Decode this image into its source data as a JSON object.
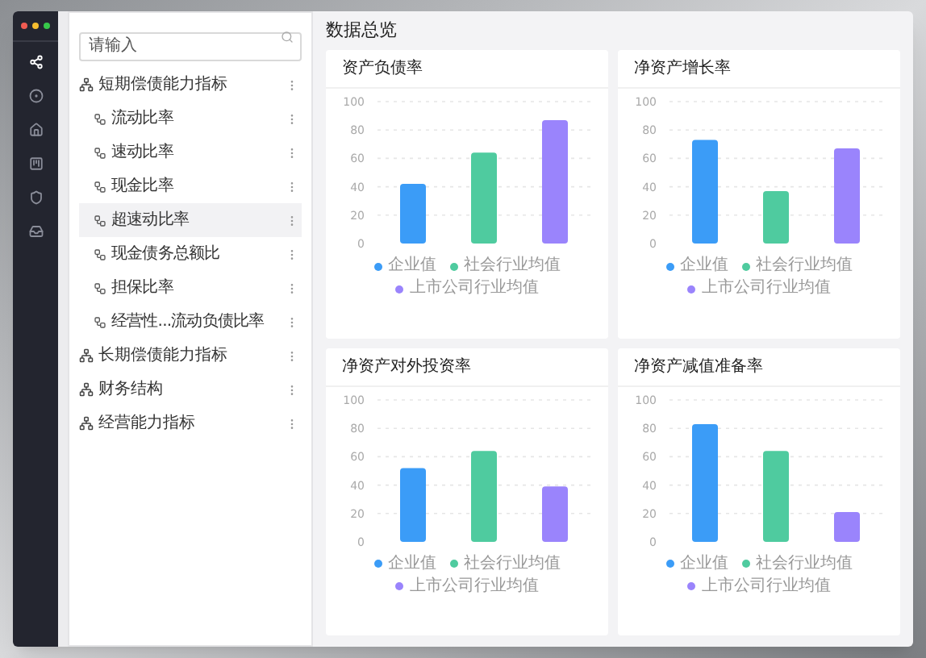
{
  "window": {
    "controls": [
      {
        "kind": "close"
      },
      {
        "kind": "minimize"
      },
      {
        "kind": "maximize"
      }
    ]
  },
  "sidebar": {
    "items": [
      {
        "selected": true
      },
      {
        "selected": false
      },
      {
        "selected": false
      },
      {
        "selected": false
      },
      {
        "selected": false
      },
      {
        "selected": false
      }
    ]
  },
  "search": {
    "placeholder": "请输入"
  },
  "tree": [
    {
      "label": "短期偿债能力指标",
      "children": [
        {
          "label": "流动比率",
          "selected": false
        },
        {
          "label": "速动比率",
          "selected": false
        },
        {
          "label": "现金比率",
          "selected": false
        },
        {
          "label": "超速动比率",
          "selected": true
        },
        {
          "label": "现金债务总额比",
          "selected": false
        },
        {
          "label": "担保比率",
          "selected": false
        },
        {
          "label": "经营性...流动负债比率",
          "selected": false
        }
      ]
    },
    {
      "label": "长期偿债能力指标"
    },
    {
      "label": "财务结构"
    },
    {
      "label": "经营能力指标"
    }
  ],
  "main": {
    "title": "数据总览",
    "cards": [
      {
        "title": "资产负债率",
        "chart_data": {
          "type": "bar",
          "grid": true,
          "legend": "bottom",
          "ylim": [
            0,
            100
          ],
          "yticks": [
            0,
            20,
            40,
            60,
            80,
            100
          ],
          "series": [
            {
              "name": "企业值",
              "color": "#3b9cf7",
              "values": [
                42
              ]
            },
            {
              "name": "社会行业均值",
              "color": "#4fcb9f",
              "values": [
                64
              ]
            },
            {
              "name": "上市公司行业均值",
              "color": "#9a84fc",
              "values": [
                87
              ]
            }
          ]
        }
      },
      {
        "title": "净资产增长率",
        "chart_data": {
          "type": "bar",
          "grid": true,
          "legend": "bottom",
          "ylim": [
            0,
            100
          ],
          "yticks": [
            0,
            20,
            40,
            60,
            80,
            100
          ],
          "series": [
            {
              "name": "企业值",
              "color": "#3b9cf7",
              "values": [
                73
              ]
            },
            {
              "name": "社会行业均值",
              "color": "#4fcb9f",
              "values": [
                37
              ]
            },
            {
              "name": "上市公司行业均值",
              "color": "#9a84fc",
              "values": [
                67
              ]
            }
          ]
        }
      },
      {
        "title": "净资产对外投资率",
        "chart_data": {
          "type": "bar",
          "grid": true,
          "legend": "bottom",
          "ylim": [
            0,
            100
          ],
          "yticks": [
            0,
            20,
            40,
            60,
            80,
            100
          ],
          "series": [
            {
              "name": "企业值",
              "color": "#3b9cf7",
              "values": [
                52
              ]
            },
            {
              "name": "社会行业均值",
              "color": "#4fcb9f",
              "values": [
                64
              ]
            },
            {
              "name": "上市公司行业均值",
              "color": "#9a84fc",
              "values": [
                39
              ]
            }
          ]
        }
      },
      {
        "title": "净资产减值准备率",
        "chart_data": {
          "type": "bar",
          "grid": true,
          "legend": "bottom",
          "ylim": [
            0,
            100
          ],
          "yticks": [
            0,
            20,
            40,
            60,
            80,
            100
          ],
          "series": [
            {
              "name": "企业值",
              "color": "#3b9cf7",
              "values": [
                83
              ]
            },
            {
              "name": "社会行业均值",
              "color": "#4fcb9f",
              "values": [
                64
              ]
            },
            {
              "name": "上市公司行业均值",
              "color": "#9a84fc",
              "values": [
                21
              ]
            }
          ]
        }
      }
    ]
  }
}
